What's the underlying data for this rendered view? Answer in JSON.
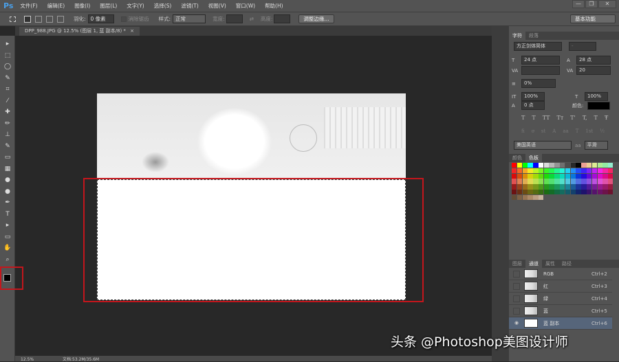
{
  "app": {
    "logo": "Ps",
    "menus": [
      "文件(F)",
      "编辑(E)",
      "图像(I)",
      "图层(L)",
      "文字(Y)",
      "选择(S)",
      "滤镜(T)",
      "视图(V)",
      "窗口(W)",
      "帮助(H)"
    ],
    "window_controls": [
      "—",
      "❐",
      "✕"
    ]
  },
  "options": {
    "feather_label": "羽化:",
    "feather_value": "0 像素",
    "antialias_label": "消除锯齿",
    "style_label": "样式:",
    "style_value": "正常",
    "width_label": "宽度:",
    "height_label": "高度:",
    "refine_edge": "调整边缘...",
    "workspace": "基本功能"
  },
  "document": {
    "tab_title": "DPP_988.JPG @ 12.5% (图层 1, 蓝 副本/8) *",
    "close": "×"
  },
  "character_panel": {
    "tabs": [
      "字符",
      "段落"
    ],
    "font_family": "方正剑体简体",
    "font_style": "-",
    "size": "24 点",
    "leading": "28 点",
    "kerning": "",
    "tracking": "20",
    "tsume": "0%",
    "vscale": "100%",
    "hscale": "100%",
    "baseline": "0 点",
    "color_label": "颜色:",
    "text_color": "#000000",
    "style_buttons": [
      "T",
      "T",
      "TT",
      "Tт",
      "T'",
      "T,",
      "T",
      "Ŧ"
    ],
    "opentype_buttons": [
      "fi",
      "ơ",
      "st",
      "A",
      "aa",
      "T",
      "1st",
      "½"
    ],
    "language": "美国英语",
    "aa_label": "aa",
    "antialias": "平滑"
  },
  "swatches_panel": {
    "tabs": [
      "颜色",
      "色板"
    ]
  },
  "channels_panel": {
    "tabs": [
      "图层",
      "通道",
      "属性",
      "路径"
    ],
    "channels": [
      {
        "name": "RGB",
        "shortcut": "Ctrl+2",
        "visible": false
      },
      {
        "name": "红",
        "shortcut": "Ctrl+3",
        "visible": false
      },
      {
        "name": "绿",
        "shortcut": "Ctrl+4",
        "visible": false
      },
      {
        "name": "蓝",
        "shortcut": "Ctrl+5",
        "visible": false
      },
      {
        "name": "蓝 副本",
        "shortcut": "Ctrl+6",
        "visible": true,
        "selected": true
      }
    ]
  },
  "status": {
    "zoom": "12.5%",
    "doc_size": "文档:53.2M/35.6M"
  },
  "watermark": "头条 @Photoshop美图设计师",
  "colors": {
    "highlight": "#c4161c",
    "selected_row": "#56657a"
  }
}
